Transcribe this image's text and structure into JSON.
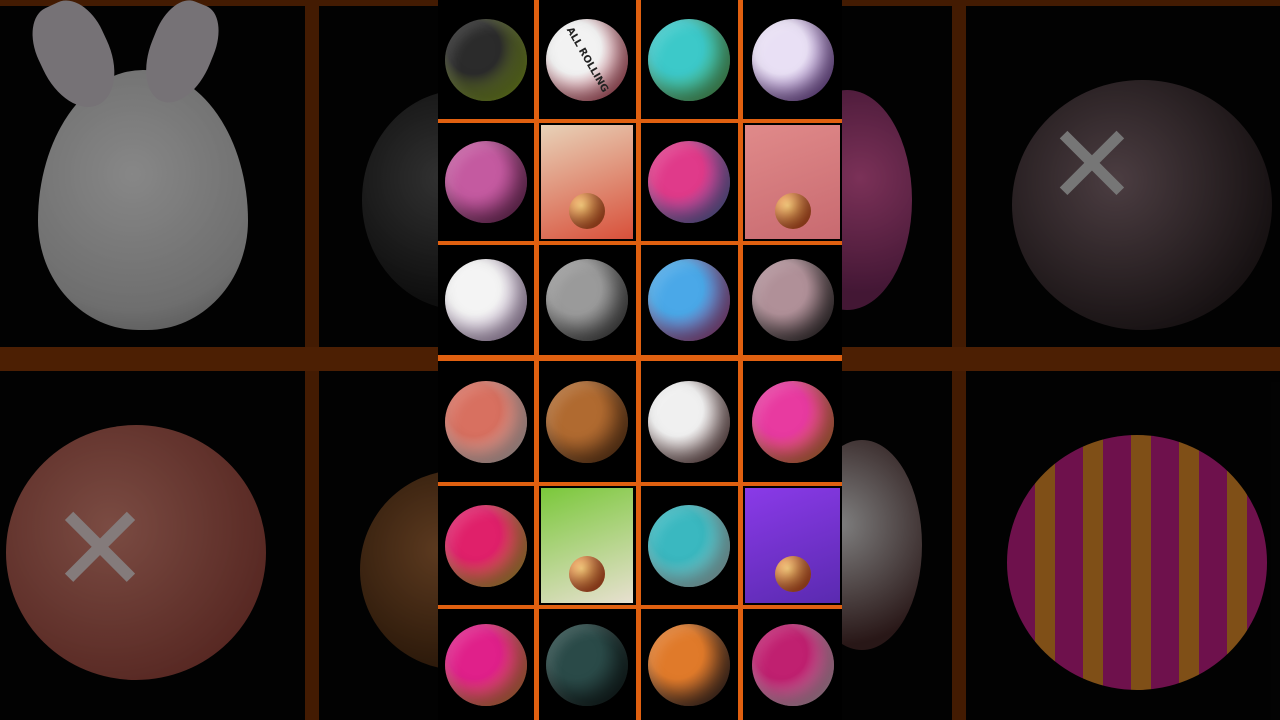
{
  "balls": [
    {
      "row": 1,
      "col": 1,
      "name": "green-chevron-ball-icon",
      "kind": "ball",
      "colors": [
        "#2b2b2b",
        "#b8e02a"
      ]
    },
    {
      "row": 1,
      "col": 2,
      "name": "all-rolling-ball-icon",
      "kind": "ball",
      "colors": [
        "#f2f2f2",
        "#d8304a"
      ],
      "text": "ALL ROLLING"
    },
    {
      "row": 1,
      "col": 3,
      "name": "earth-lowpoly-ball-icon",
      "kind": "ball",
      "colors": [
        "#3cc9c9",
        "#6fbf4a"
      ]
    },
    {
      "row": 1,
      "col": 4,
      "name": "planet-ring-ball-icon",
      "kind": "ball",
      "colors": [
        "#e9e0f5",
        "#6a2aa0"
      ]
    },
    {
      "row": 2,
      "col": 1,
      "name": "basketball-pink-icon",
      "kind": "ball",
      "colors": [
        "#c45aa0",
        "#7a2a60"
      ]
    },
    {
      "row": 2,
      "col": 2,
      "name": "track-scene-spiky-ball",
      "kind": "scene",
      "colors": [
        "#e8d2b8",
        "#d8503a"
      ]
    },
    {
      "row": 2,
      "col": 3,
      "name": "captain-shield-ball-icon",
      "kind": "ball",
      "colors": [
        "#e03a8a",
        "#4a8ad8"
      ]
    },
    {
      "row": 2,
      "col": 4,
      "name": "track-scene-cubes",
      "kind": "scene",
      "colors": [
        "#e08a8a",
        "#c86a70"
      ]
    },
    {
      "row": 3,
      "col": 1,
      "name": "bunny-egg-ball-icon",
      "kind": "ball",
      "colors": [
        "#f4f4f4",
        "#c8a0d8"
      ]
    },
    {
      "row": 3,
      "col": 2,
      "name": "metal-moon-ball-icon",
      "kind": "ball",
      "colors": [
        "#9a9a9a",
        "#3a3a3a"
      ]
    },
    {
      "row": 3,
      "col": 3,
      "name": "blue-pink-star-ball-icon",
      "kind": "ball",
      "colors": [
        "#4aa8e8",
        "#e03a8a"
      ]
    },
    {
      "row": 3,
      "col": 4,
      "name": "grey-cross-ball-icon",
      "kind": "ball",
      "colors": [
        "#b09098",
        "#1a1a1a"
      ]
    },
    {
      "row": 4,
      "col": 1,
      "name": "red-cross-ball-icon",
      "kind": "ball",
      "colors": [
        "#d87060",
        "#ffffff"
      ]
    },
    {
      "row": 4,
      "col": 2,
      "name": "wooden-blocks-ball-icon",
      "kind": "ball",
      "colors": [
        "#b06a30",
        "#6a3a18"
      ]
    },
    {
      "row": 4,
      "col": 3,
      "name": "coconut-ball-icon",
      "kind": "ball",
      "colors": [
        "#f0f0f0",
        "#5a2a2a"
      ]
    },
    {
      "row": 4,
      "col": 4,
      "name": "circus-ball-icon",
      "kind": "ball",
      "colors": [
        "#e83aa0",
        "#f0a020"
      ]
    },
    {
      "row": 5,
      "col": 1,
      "name": "pink-yellow-ball-icon",
      "kind": "ball",
      "colors": [
        "#e0206a",
        "#d8e030"
      ]
    },
    {
      "row": 5,
      "col": 2,
      "name": "candy-track-scene",
      "kind": "scene",
      "colors": [
        "#7ac83a",
        "#e8e0d0"
      ]
    },
    {
      "row": 5,
      "col": 3,
      "name": "earth-ball-icon",
      "kind": "ball",
      "colors": [
        "#3ab8c0",
        "#e8f8f8"
      ]
    },
    {
      "row": 5,
      "col": 4,
      "name": "purple-track-scene",
      "kind": "scene",
      "colors": [
        "#8a3ae8",
        "#5a2ab0"
      ]
    },
    {
      "row": 6,
      "col": 1,
      "name": "paw-print-ball-icon",
      "kind": "ball",
      "colors": [
        "#e0208a",
        "#f0b030"
      ]
    },
    {
      "row": 6,
      "col": 2,
      "name": "dark-teal-ball-icon",
      "kind": "ball",
      "colors": [
        "#2a4a48",
        "#101818"
      ]
    },
    {
      "row": 6,
      "col": 3,
      "name": "hex-orange-ball-icon",
      "kind": "ball",
      "colors": [
        "#e07a2a",
        "#1a1a2a"
      ]
    },
    {
      "row": 6,
      "col": 4,
      "name": "angry-face-ball-icon",
      "kind": "ball",
      "colors": [
        "#c02070",
        "#f0f0f0"
      ]
    }
  ],
  "colors": {
    "grid_line": "#e06010",
    "background": "#000000"
  }
}
